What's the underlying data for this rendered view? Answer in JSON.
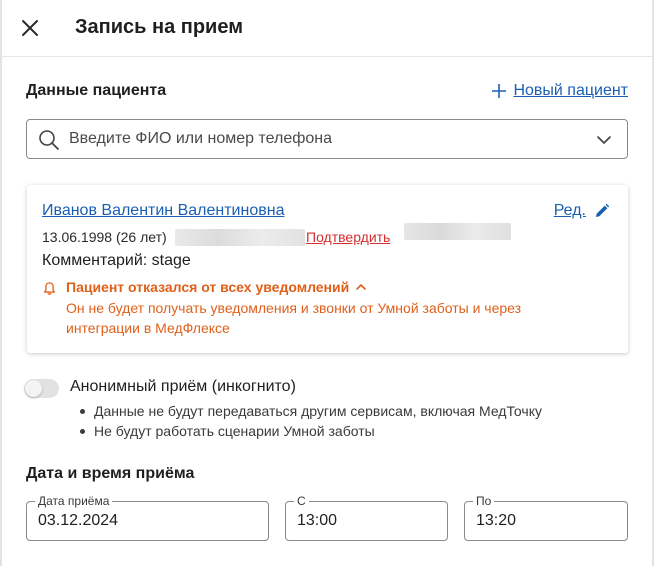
{
  "header": {
    "title": "Запись на прием",
    "close_icon": "close-icon"
  },
  "patient_section": {
    "title": "Данные пациента",
    "new_patient_label": "Новый пациент",
    "search_placeholder": "Введите ФИО или номер телефона"
  },
  "patient_card": {
    "name": "Иванов Валентин Валентиновна",
    "edit_label": "Ред.",
    "birth": "13.06.1998 (26 лет)",
    "confirm_label": "Подтвердить",
    "comment": "Комментарий: stage",
    "warning_title": "Пациент отказался от всех уведомлений",
    "warning_text": "Он не будет получать уведомления и звонки от Умной заботы и через интеграции в МедФлексе",
    "warning_color": "#e0601a",
    "link_color": "#1a5fb4"
  },
  "anonymous": {
    "label": "Анонимный приём (инкогнито)",
    "enabled": false,
    "bullets": [
      "Данные не будут передаваться другим сервисам, включая МедТочку",
      "Не будут работать сценарии Умной заботы"
    ]
  },
  "datetime_section": {
    "title": "Дата и время приёма",
    "date_label": "Дата приёма",
    "date_value": "03.12.2024",
    "from_label": "С",
    "from_value": "13:00",
    "to_label": "По",
    "to_value": "13:20"
  }
}
